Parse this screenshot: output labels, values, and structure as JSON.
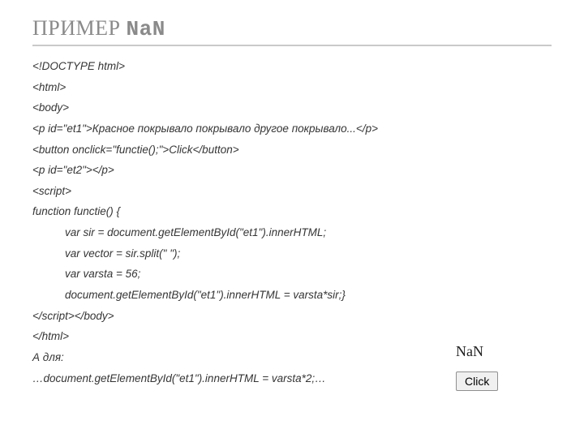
{
  "title": {
    "main": "ПРИМЕР ",
    "mono": "NaN"
  },
  "code": {
    "l0": "<!DOCTYPE html>",
    "l1": "<html>",
    "l2": "<body>",
    "l3": "<p id=\"et1\">Красное покрывало покрывало другое покрывало...</p>",
    "l4": "<button onclick=\"functie();\">Click</button>",
    "l5": "<p id=\"et2\"></p>",
    "l6": "<script>",
    "l7": "function functie() {",
    "l8": "var sir = document.getElementById(\"et1\").innerHTML;",
    "l9": "var vector = sir.split(\" \");",
    "l10": "var varsta = 56;",
    "l11": "document.getElementById(\"et1\").innerHTML = varsta*sir;}",
    "l12": "</script></body>",
    "l13": "</html>",
    "l14": "",
    "l15": "А для:",
    "l16": "…document.getElementById(\"et1\").innerHTML = varsta*2;…"
  },
  "output": {
    "nan": "NaN",
    "button": "Click"
  }
}
